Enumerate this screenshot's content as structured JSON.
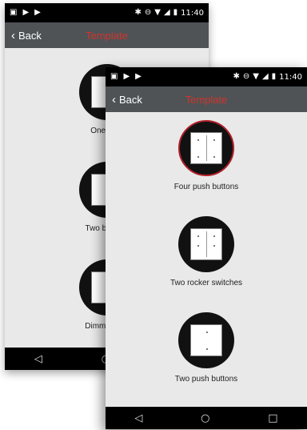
{
  "status_bar": {
    "time": "11:40",
    "left_icons": [
      "image-icon",
      "play-store-icon",
      "play-store-icon"
    ],
    "right_icons": [
      "bluetooth-icon",
      "minus-circle-icon",
      "wifi-icon",
      "signal-icon",
      "battery-icon"
    ]
  },
  "back_screen": {
    "back_label": "Back",
    "title": "Template",
    "items": [
      {
        "label": "One rocker switch",
        "visible_label": "One rock"
      },
      {
        "label": "Two buttons",
        "visible_label": "Two buttons"
      },
      {
        "label": "Dimmer and",
        "visible_label": "Dimmer and"
      }
    ]
  },
  "front_screen": {
    "back_label": "Back",
    "title": "Template",
    "items": [
      {
        "label": "Four push buttons",
        "selected": true
      },
      {
        "label": "Two rocker switches",
        "selected": false
      },
      {
        "label": "Two push buttons",
        "selected": false
      }
    ]
  },
  "nav_bar": {
    "back": "◁",
    "home": "○",
    "recents": "□"
  },
  "colors": {
    "header_bg": "#4f5356",
    "title_color": "#d0342c",
    "content_bg": "#e9e9e9",
    "selected_ring": "#b0202a"
  }
}
